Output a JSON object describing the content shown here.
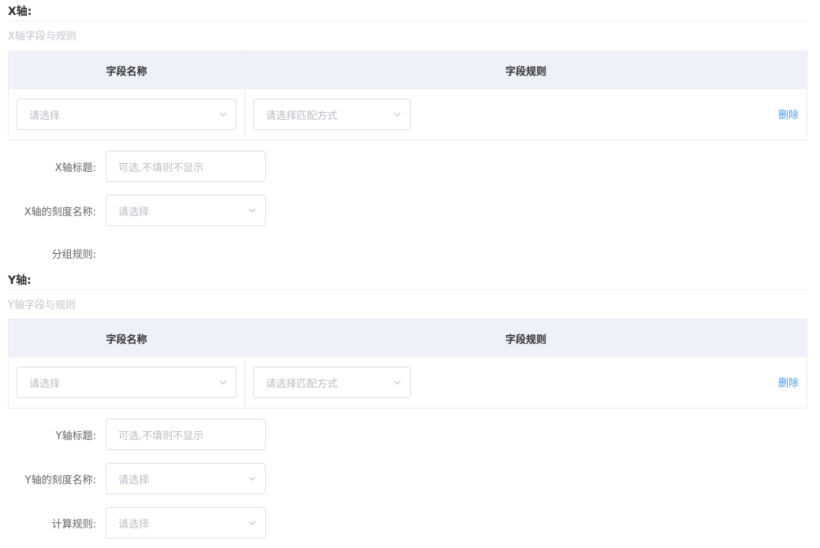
{
  "x_axis": {
    "title": "X轴:",
    "subtitle": "X轴字段与规则",
    "table": {
      "col_field_name": "字段名称",
      "col_field_rule": "字段规则",
      "row": {
        "field_select_placeholder": "请选择",
        "rule_select_placeholder": "请选择匹配方式",
        "delete_label": "删除"
      }
    },
    "axis_title_label": "X轴标题:",
    "axis_title_placeholder": "可选,不填则不显示",
    "tick_name_label": "X轴的刻度名称:",
    "tick_name_placeholder": "请选择",
    "group_rule_label": "分组规则:"
  },
  "y_axis": {
    "title": "Y轴:",
    "subtitle": "Y轴字段与规则",
    "table": {
      "col_field_name": "字段名称",
      "col_field_rule": "字段规则",
      "row": {
        "field_select_placeholder": "请选择",
        "rule_select_placeholder": "请选择匹配方式",
        "delete_label": "删除"
      }
    },
    "axis_title_label": "Y轴标题:",
    "axis_title_placeholder": "可选,不填则不显示",
    "tick_name_label": "Y轴的刻度名称:",
    "tick_name_placeholder": "请选择",
    "calc_rule_label": "计算规则:",
    "calc_rule_placeholder": "请选择"
  },
  "colors": {
    "link": "#409eff",
    "header_bg": "#eef1f8",
    "border": "#dcdfe6",
    "placeholder": "#b8bcc4"
  }
}
